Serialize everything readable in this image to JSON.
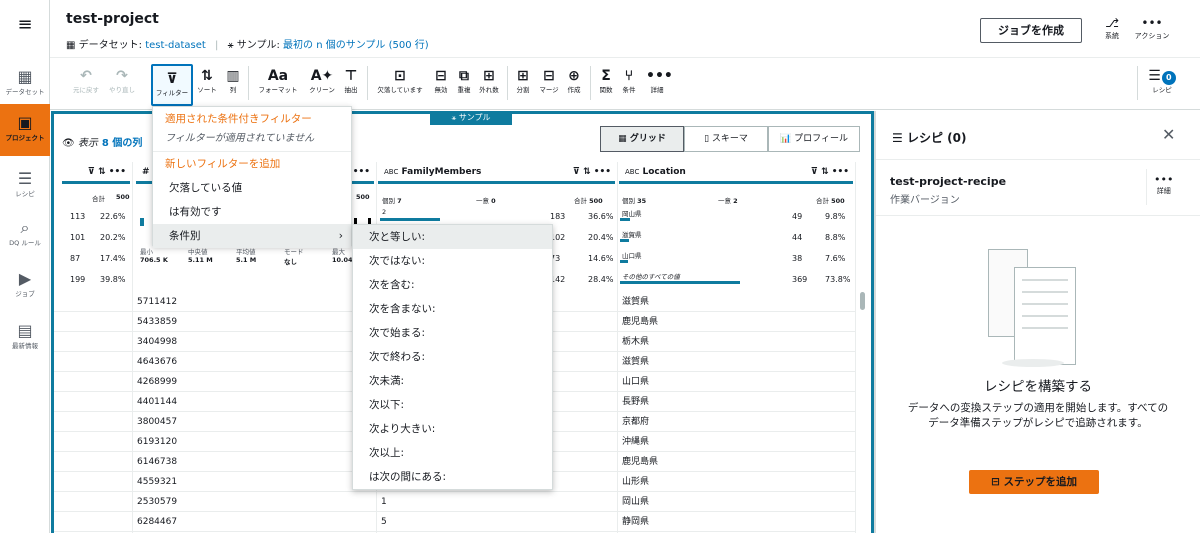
{
  "nav": {
    "items": [
      {
        "label": "データセット",
        "icon": "table-icon"
      },
      {
        "label": "プロジェクト",
        "icon": "project-icon"
      },
      {
        "label": "レシピ",
        "icon": "recipe-icon"
      },
      {
        "label": "DQ ルール",
        "icon": "dq-rules-icon"
      },
      {
        "label": "ジョブ",
        "icon": "job-icon"
      },
      {
        "label": "最新情報",
        "icon": "news-icon"
      }
    ]
  },
  "header": {
    "title": "test-project",
    "dataset_label": "データセット:",
    "dataset_name": "test-dataset",
    "sample_label": "サンプル:",
    "sample_value": "最初の n 個のサンプル (500 行)",
    "create_job": "ジョブを作成",
    "lineage": "系統",
    "actions": "アクション"
  },
  "toolbar": {
    "undo": "元に戻す",
    "redo": "やり直し",
    "filter": "フィルター",
    "sort": "ソート",
    "column": "列",
    "format": "フォーマット",
    "clean": "クリーン",
    "extract": "抽出",
    "missing": "欠落しています",
    "invalid": "無効",
    "duplicate": "重複",
    "outlier": "外れ数",
    "split": "分割",
    "merge": "マージ",
    "create": "作成",
    "functions": "関数",
    "condition": "条件",
    "details": "詳細",
    "recipe": "レシピ",
    "recipe_count": "0"
  },
  "sample_tag": "サンプル",
  "view": {
    "label": "表示",
    "count": "8 個の列",
    "grid": "グリッド",
    "schema": "スキーマ",
    "profile": "プロフィール"
  },
  "grid": {
    "col1": {
      "header": "",
      "stats_total_label": "合計",
      "stats_total": "500",
      "rows": [
        [
          "113",
          "22.6%"
        ],
        [
          "101",
          "20.2%"
        ],
        [
          "87",
          "17.4%"
        ],
        [
          "199",
          "39.8%"
        ]
      ]
    },
    "col2": {
      "header": "#",
      "stats_total": "500",
      "bottom_stats": [
        [
          "最小",
          "706.5 K"
        ],
        [
          "中央値",
          "5.11 M"
        ],
        [
          "平均値",
          "5.1 M"
        ],
        [
          "モード",
          "なし"
        ],
        [
          "最大",
          "10.04 M"
        ]
      ],
      "values": [
        "5711412",
        "5433859",
        "3404998",
        "4643676",
        "4268999",
        "4401144",
        "3800457",
        "6193120",
        "6146738",
        "4559321",
        "2530579",
        "6284467"
      ]
    },
    "col3": {
      "type": "ABC",
      "header": "FamilyMembers",
      "distinct_label": "個別",
      "distinct": "7",
      "unique_label": "一意",
      "unique": "0",
      "total_label": "合計",
      "total": "500",
      "top": [
        [
          "2",
          "183",
          "36.6%"
        ],
        [
          "",
          "102",
          "20.4%"
        ],
        [
          "",
          "73",
          "14.6%"
        ],
        [
          "",
          "142",
          "28.4%"
        ]
      ],
      "values": [
        "",
        "",
        "",
        "",
        "",
        "",
        "",
        "",
        "",
        "",
        "1",
        "5"
      ]
    },
    "col4": {
      "type": "ABC",
      "header": "Location",
      "distinct_label": "個別",
      "distinct": "35",
      "unique_label": "一意",
      "unique": "2",
      "total_label": "合計",
      "total": "500",
      "top": [
        [
          "岡山県",
          "49",
          "9.8%"
        ],
        [
          "滋賀県",
          "44",
          "8.8%"
        ],
        [
          "山口県",
          "38",
          "7.6%"
        ],
        [
          "その他のすべての値",
          "369",
          "73.8%"
        ]
      ],
      "values": [
        "滋賀県",
        "鹿児島県",
        "栃木県",
        "滋賀県",
        "山口県",
        "長野県",
        "京都府",
        "沖縄県",
        "鹿児島県",
        "山形県",
        "岡山県",
        "静岡県"
      ]
    }
  },
  "filter_menu": {
    "applied_header": "適用された条件付きフィルター",
    "none_applied": "フィルターが適用されていません",
    "add_new": "新しいフィルターを追加",
    "missing": "欠落している値",
    "valid": "は有効です",
    "by_condition": "条件別"
  },
  "condition_menu": [
    "次と等しい:",
    "次ではない:",
    "次を含む:",
    "次を含まない:",
    "次で始まる:",
    "次で終わる:",
    "次未満:",
    "次以下:",
    "次より大きい:",
    "次以上:",
    "は次の間にある:"
  ],
  "recipe": {
    "title": "レシピ (0)",
    "name": "test-project-recipe",
    "version": "作業バージョン",
    "details": "詳細",
    "empty_title": "レシピを構築する",
    "empty_desc": "データへの変換ステップの適用を開始します。すべてのデータ準備ステップがレシピで追跡されます。",
    "add_step": "ステップを追加"
  }
}
